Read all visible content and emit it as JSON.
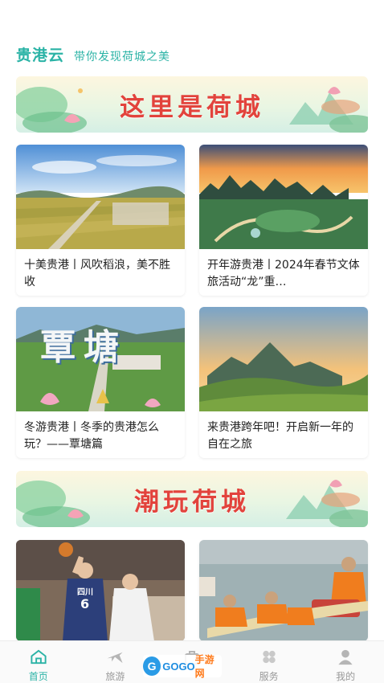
{
  "header": {
    "brand": "贵港云",
    "slogan": "带你发现荷城之美"
  },
  "banners": [
    {
      "title": "这里是荷城"
    },
    {
      "title": "潮玩荷城"
    }
  ],
  "articles": [
    {
      "title": "十美贵港丨风吹稻浪，美不胜收"
    },
    {
      "title": "开年游贵港丨2024年春节文体旅活动“龙”重…"
    },
    {
      "title": "冬游贵港丨冬季的贵港怎么玩？——覃塘篇",
      "image_text": "覃塘"
    },
    {
      "title": "来贵港跨年吧！开启新一年的自在之旅"
    },
    {
      "title": "",
      "image_text": "四川",
      "jersey_number": "6"
    },
    {
      "title": ""
    }
  ],
  "tabbar": {
    "items": [
      {
        "label": "首页",
        "icon": "home-icon",
        "active": true
      },
      {
        "label": "旅游",
        "icon": "travel-icon",
        "active": false
      },
      {
        "label": "",
        "icon": "center-icon",
        "active": false
      },
      {
        "label": "服务",
        "icon": "service-icon",
        "active": false
      },
      {
        "label": "我的",
        "icon": "profile-icon",
        "active": false
      }
    ]
  },
  "watermark": {
    "letter": "G",
    "text": "GOGO",
    "suffix": "手游网"
  },
  "colors": {
    "accent": "#2bb3a6",
    "banner_title": "#e2433c",
    "inactive": "#999999"
  }
}
